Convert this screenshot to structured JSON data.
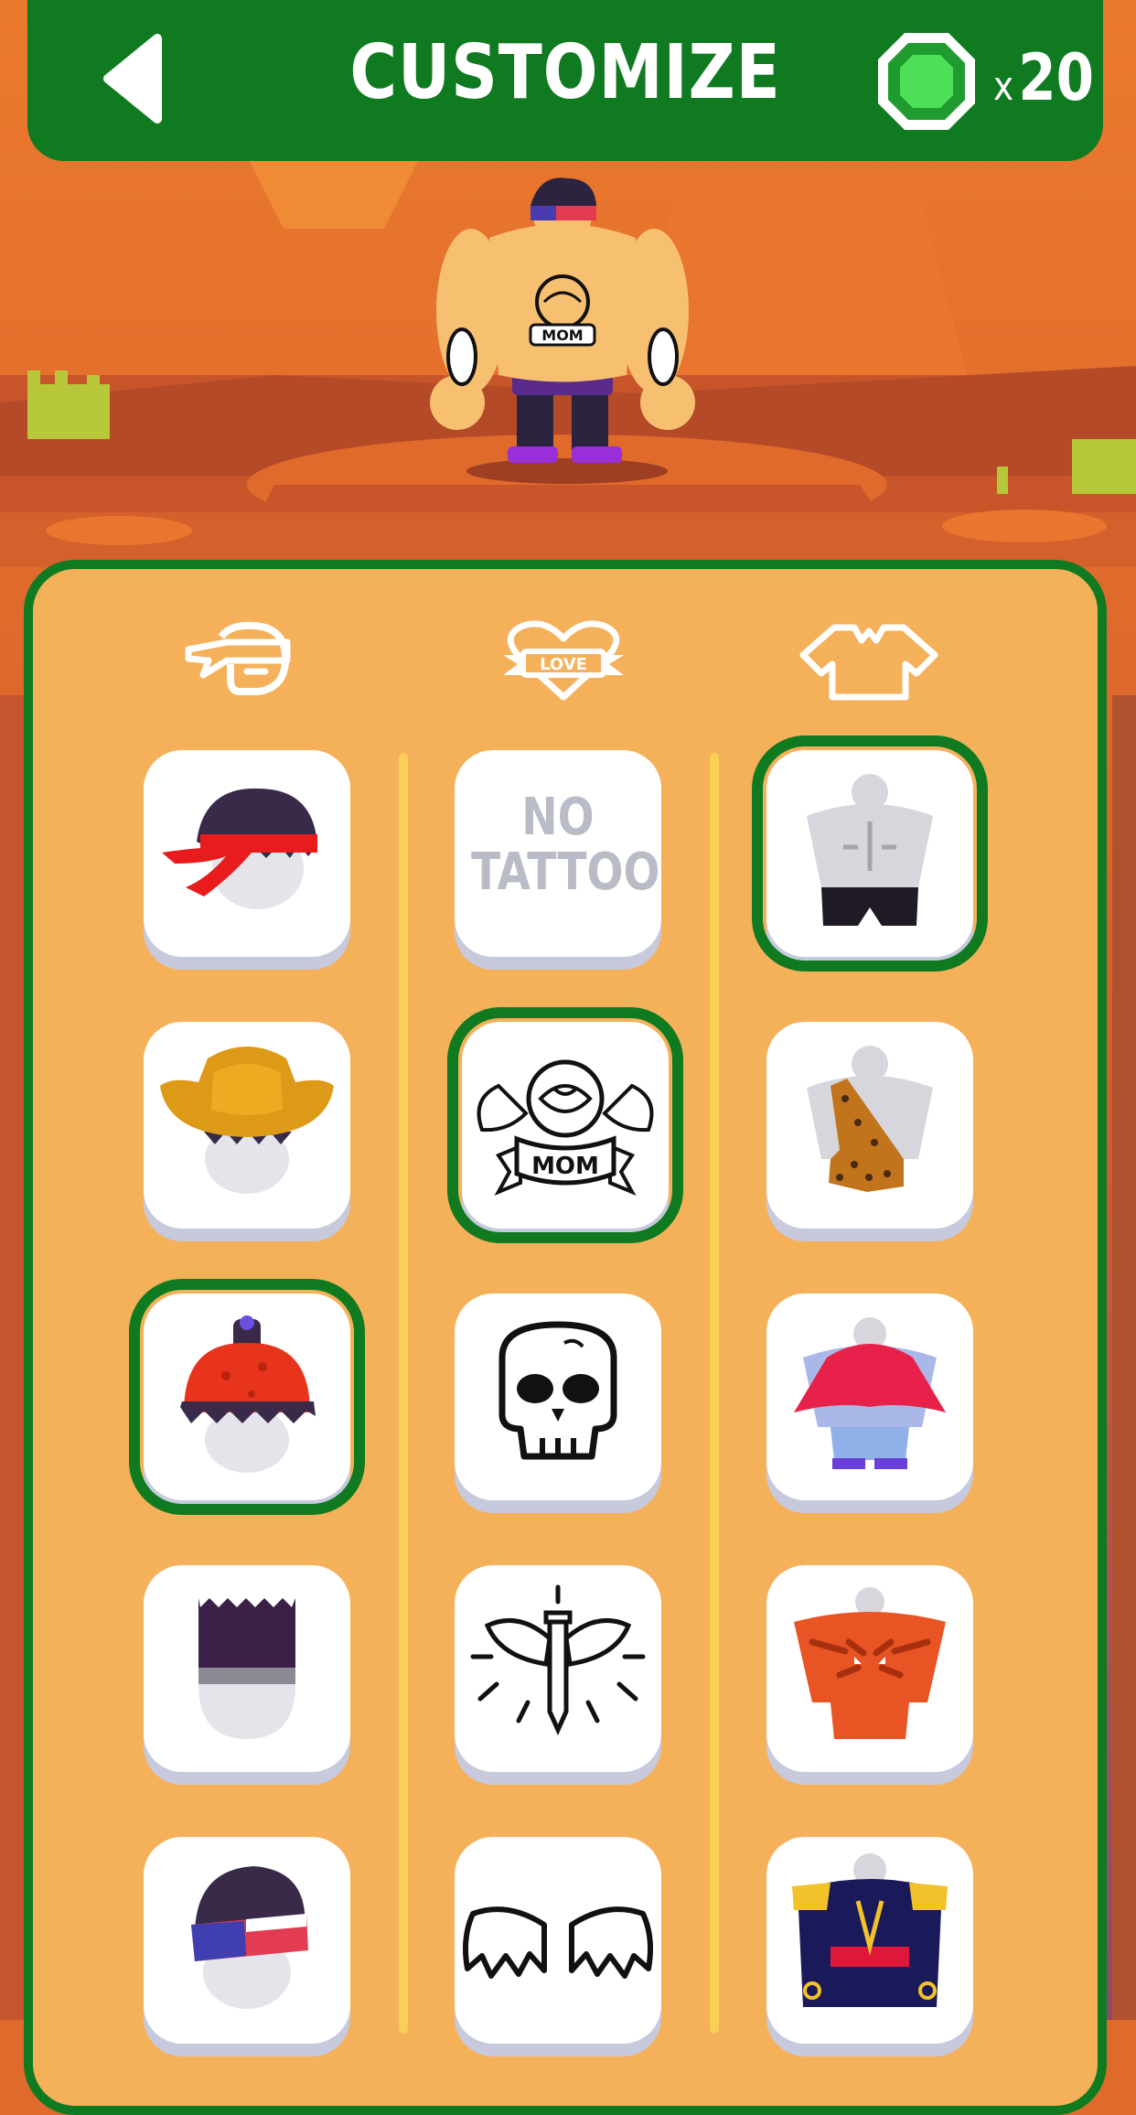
{
  "header": {
    "title": "CUSTOMIZE",
    "gem_multiplier": "x",
    "gem_count": "20",
    "back_icon": "back-arrow-icon",
    "currency_icon": "green-gem-icon"
  },
  "colors": {
    "header_green": "#0f7a1f",
    "panel": "#f5b05a",
    "background": "#e06a2b",
    "divider": "#f9cf56"
  },
  "categories": [
    {
      "name": "headgear",
      "icon": "bandana-head-icon"
    },
    {
      "name": "tattoos",
      "icon": "love-heart-tattoo-icon",
      "label": "LOVE"
    },
    {
      "name": "outfits",
      "icon": "torn-shirt-icon"
    }
  ],
  "headgear_items": [
    {
      "icon": "red-headband-hair-icon",
      "selected": false
    },
    {
      "icon": "cowboy-hat-icon",
      "selected": false
    },
    {
      "icon": "red-beanie-icon",
      "selected": true
    },
    {
      "icon": "tall-hair-icon",
      "selected": false
    },
    {
      "icon": "flag-bandana-hair-icon",
      "selected": false
    }
  ],
  "tattoo_items": [
    {
      "label": "NO TATTOO",
      "icon": "no-tattoo",
      "selected": false
    },
    {
      "icon": "rose-mom-tattoo-icon",
      "banner": "MOM",
      "selected": true
    },
    {
      "icon": "skull-tattoo-icon",
      "selected": false
    },
    {
      "icon": "winged-sword-tattoo-icon",
      "selected": false
    },
    {
      "icon": "bat-wings-tattoo-icon",
      "selected": false
    }
  ],
  "outfit_items": [
    {
      "icon": "bare-torso-shorts-icon",
      "selected": true
    },
    {
      "icon": "leopard-caveman-outfit-icon",
      "selected": false
    },
    {
      "icon": "red-cape-outfit-icon",
      "selected": false
    },
    {
      "icon": "tiger-costume-icon",
      "selected": false
    },
    {
      "icon": "matador-jacket-icon",
      "selected": false
    }
  ],
  "character": {
    "tattoo_banner": "MOM"
  }
}
